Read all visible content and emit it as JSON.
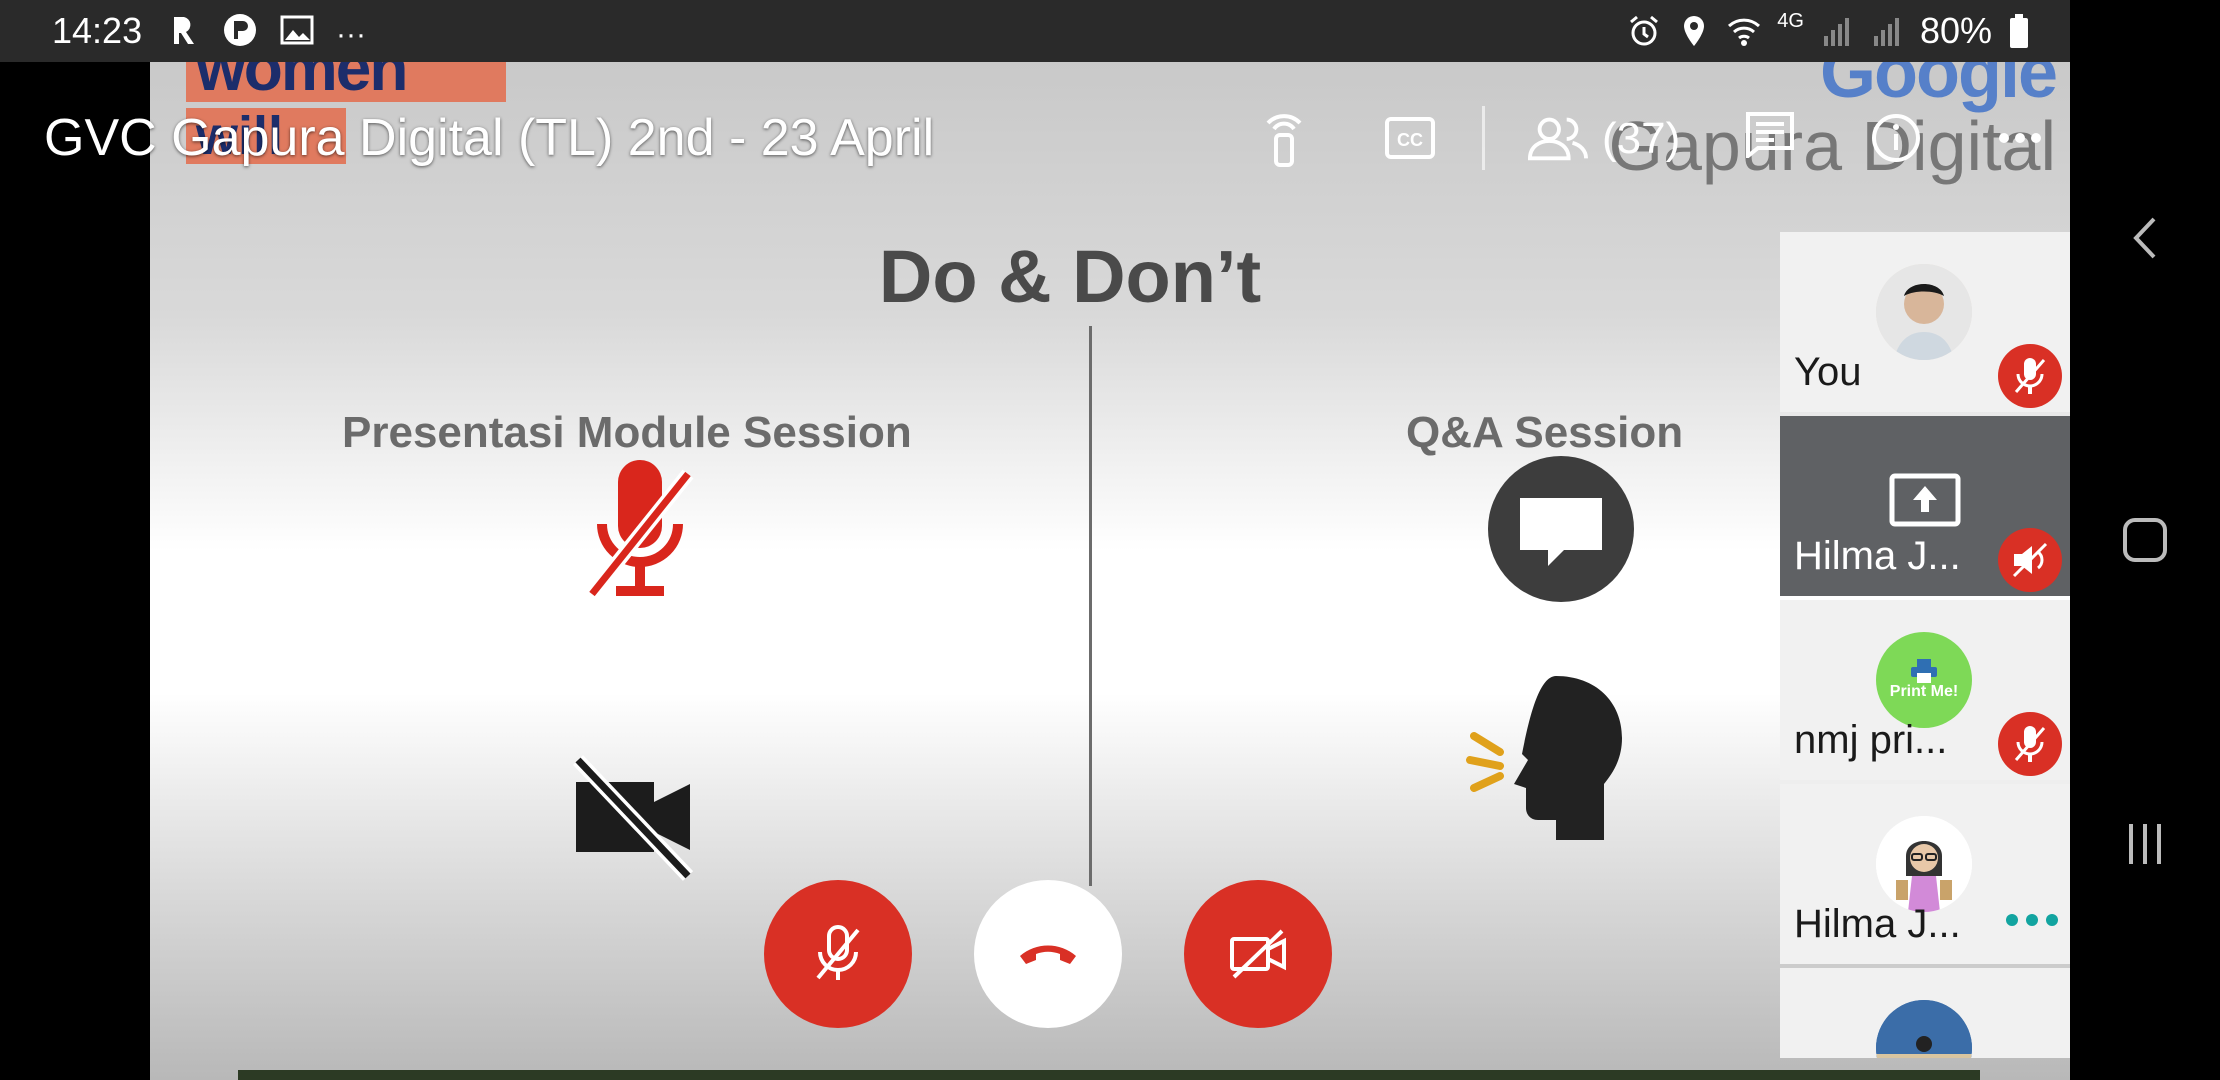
{
  "status_bar": {
    "time": "14:23",
    "left_icons": [
      "r-app-icon",
      "p-app-icon",
      "gallery-icon",
      "more-notifications-icon"
    ],
    "overflow": "···",
    "network_label": "4G",
    "battery": "80%"
  },
  "meeting": {
    "title": "GVC Gapura Digital (TL) 2nd - 23 April",
    "participant_count": "(37)"
  },
  "slide": {
    "brand_left_line1": "women",
    "brand_left_line2": "will",
    "brand_right_line1": "Google",
    "brand_right_line2": "Gapura Digital",
    "title": "Do & Don’t",
    "left_heading": "Presentasi Module Session",
    "right_heading": "Q&A Session"
  },
  "participants": [
    {
      "name": "You",
      "status": "muted"
    },
    {
      "name": "Hilma J...",
      "status": "presenting-audio-muted"
    },
    {
      "name": "nmj pri...",
      "status": "muted",
      "avatar_text": "Print Me!"
    },
    {
      "name": "Hilma J...",
      "status": "speaking"
    },
    {
      "name": "",
      "status": "partial"
    }
  ],
  "colors": {
    "accent_red": "#d93025",
    "dark_tile": "#5f6164",
    "teal_dots": "#12a4a0"
  }
}
